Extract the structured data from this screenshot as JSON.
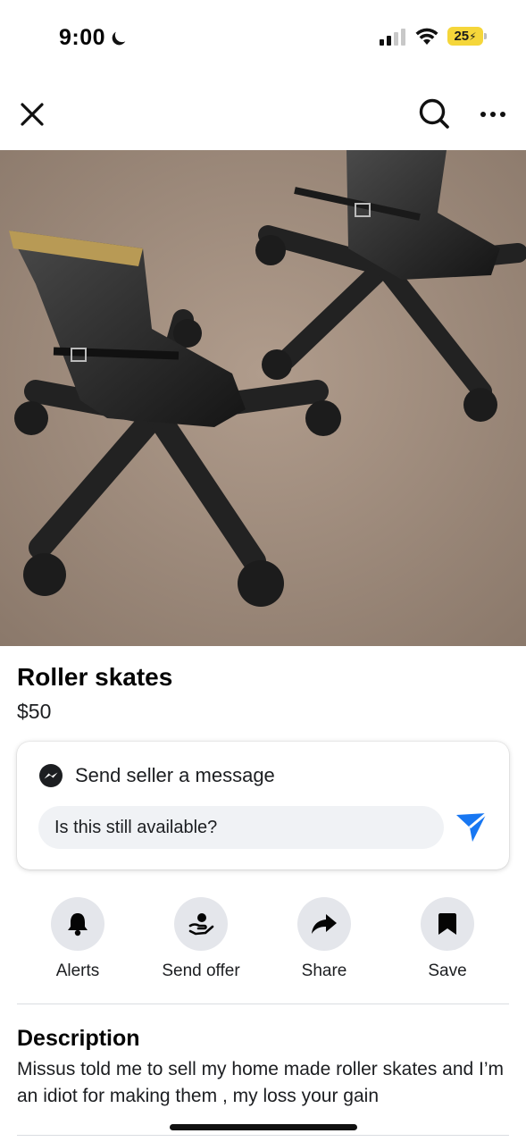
{
  "status_bar": {
    "time": "9:00",
    "battery": "25"
  },
  "nav": {
    "close_icon": "close-icon",
    "search_icon": "search-icon",
    "more_icon": "more-icon"
  },
  "listing": {
    "photo_icon": "listing-photo",
    "title": "Roller skates",
    "price": "$50"
  },
  "message_card": {
    "heading": "Send seller a message",
    "input_value": "Is this still available?",
    "accent_color": "#1877f2"
  },
  "actions": [
    {
      "label": "Alerts",
      "icon": "bell-icon"
    },
    {
      "label": "Send offer",
      "icon": "offer-icon"
    },
    {
      "label": "Share",
      "icon": "share-icon"
    },
    {
      "label": "Save",
      "icon": "bookmark-icon"
    }
  ],
  "description": {
    "heading": "Description",
    "body": "Missus told me to sell my home made roller skates and I’m an idiot for making them , my loss your gain"
  }
}
